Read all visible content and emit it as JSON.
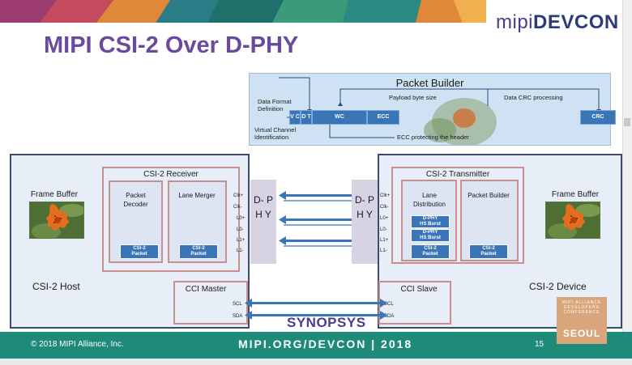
{
  "header": {
    "logo_prefix": "mipi",
    "logo_suffix": "DEVCON",
    "title": "MIPI CSI-2 Over D-PHY"
  },
  "packet_builder": {
    "title": "Packet Builder",
    "data_format_definition": "Data Format Definition",
    "virtual_channel_identification": "Virtual Channel Identification",
    "payload_byte_size": "Payload byte size",
    "data_crc_processing": "Data CRC processing",
    "ecc_protecting_header": "ECC protecting the header",
    "cells": {
      "vc": "V C",
      "dt": "D T",
      "wc": "WC",
      "ecc": "ECC",
      "crc": "CRC"
    }
  },
  "host": {
    "name": "CSI-2 Host",
    "frame_buffer": "Frame Buffer",
    "receiver_title": "CSI-2 Receiver",
    "packet_decoder": "Packet Decoder",
    "lane_merger": "Lane Merger",
    "packet_chip_line1": "CSI-2",
    "packet_chip_line2": "Packet",
    "cci_master": "CCI Master",
    "dphy_label": "D- P H Y"
  },
  "device": {
    "name": "CSI-2 Device",
    "frame_buffer": "Frame Buffer",
    "transmitter_title": "CSI-2 Transmitter",
    "lane_distribution": "Lane Distribution",
    "packet_builder": "Packet Builder",
    "hs_burst_line1": "D-PHY",
    "hs_burst_line2": "HS Burst",
    "packet_chip_line1": "CSI-2",
    "packet_chip_line2": "Packet",
    "cci_slave": "CCI Slave",
    "dphy_label": "D- P H Y"
  },
  "pins": [
    "Clk+",
    "Clk-",
    "L0+",
    "L0-",
    "L1+",
    "L1-"
  ],
  "cci_pins": [
    "SCL",
    "SDA"
  ],
  "footer": {
    "copyright": "© 2018 MIPI Alliance, Inc.",
    "url": "MIPI.ORG/DEVCON | 2018",
    "page": "15",
    "sponsor": "SYNOPSYS",
    "badge_text": "MIPI ALLIANCE DEVELOPERS CONFERENCE",
    "badge_city": "SEOUL"
  },
  "colors": {
    "title": "#6a4a9c",
    "footer": "#1e8a79",
    "arrow": "#3a75b8",
    "packet_panel": "#cfe2f3"
  }
}
